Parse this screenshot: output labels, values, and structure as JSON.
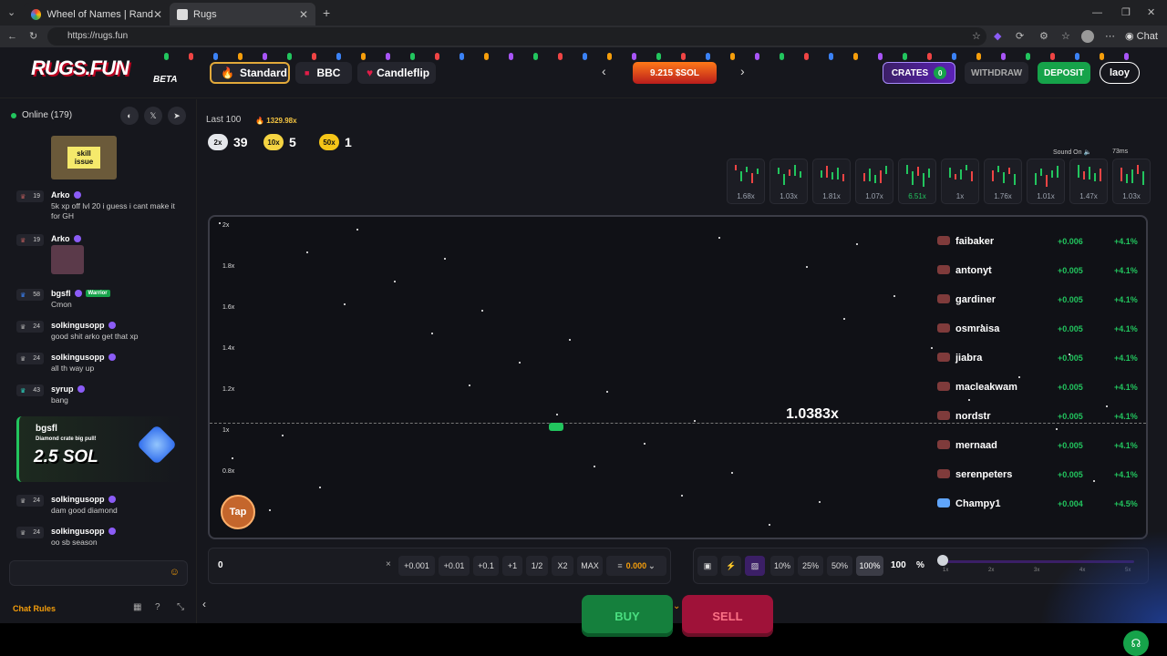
{
  "browser": {
    "tabs": [
      {
        "title": "Wheel of Names | Random name pi"
      },
      {
        "title": "Rugs"
      }
    ],
    "url": "https://rugs.fun"
  },
  "header": {
    "logo": "RUGS.FUN",
    "beta": "BETA",
    "modes": [
      "Standard",
      "BBC",
      "Candleflip"
    ],
    "pot": "9.215 $SOL",
    "crates": "CRATES",
    "crates_count": "0",
    "withdraw": "WITHDRAW",
    "deposit": "DEPOSIT",
    "user": "laoy"
  },
  "sidebar": {
    "online": "Online (179)",
    "messages": [
      {
        "level": "19",
        "name": "Arko",
        "text": "5k xp off lvl 20 i guess i cant make it for GH"
      },
      {
        "level": "19",
        "name": "Arko",
        "text": ""
      },
      {
        "level": "58",
        "name": "bgsfl",
        "text": "Cmon",
        "tag": "Warrior"
      },
      {
        "level": "24",
        "name": "solkingusopp",
        "text": "good shit arko get that xp"
      },
      {
        "level": "24",
        "name": "solkingusopp",
        "text": "all th way up"
      },
      {
        "level": "43",
        "name": "syrup",
        "text": "bang"
      },
      {
        "level": "24",
        "name": "solkingusopp",
        "text": "dam good diamond"
      },
      {
        "level": "24",
        "name": "solkingusopp",
        "text": "oo sb season"
      }
    ],
    "skill_issue": "skill issue",
    "crate_pull": {
      "name": "bgsfl",
      "text": "Diamond crate big pull!",
      "amount": "2.5 SOL"
    },
    "chat_rules": "Chat Rules"
  },
  "stats": {
    "last100_label": "Last 100",
    "last100_sol": "1329.98x",
    "badges": [
      {
        "mult": "2x",
        "count": "39",
        "color": "#e5e7eb"
      },
      {
        "mult": "10x",
        "count": "5",
        "color": "#f5d442"
      },
      {
        "mult": "50x",
        "count": "1",
        "color": "#f5c518"
      }
    ],
    "history": [
      "1.68x",
      "1.03x",
      "1.81x",
      "1.07x",
      "6.51x",
      "1x",
      "1.76x",
      "1.01x",
      "1.47x",
      "1.03x"
    ],
    "sound": "Sound On",
    "ping": "73ms"
  },
  "chart": {
    "ylabels": [
      "2x",
      "1.8x",
      "1.6x",
      "1.4x",
      "1.2x",
      "1x",
      "0.8x"
    ],
    "multiplier": "1.0383x",
    "tap": "Tap",
    "players": [
      {
        "name": "faibaker",
        "amount": "+0.006",
        "pct": "+4.1%"
      },
      {
        "name": "antonyt",
        "amount": "+0.005",
        "pct": "+4.1%"
      },
      {
        "name": "gardiner",
        "amount": "+0.005",
        "pct": "+4.1%"
      },
      {
        "name": "osmraisa",
        "amount": "+0.005",
        "pct": "+4.1%"
      },
      {
        "name": "jiabra",
        "amount": "+0.005",
        "pct": "+4.1%"
      },
      {
        "name": "macleakwam",
        "amount": "+0.005",
        "pct": "+4.1%"
      },
      {
        "name": "nordstr",
        "amount": "+0.005",
        "pct": "+4.1%"
      },
      {
        "name": "mernaad",
        "amount": "+0.005",
        "pct": "+4.1%"
      },
      {
        "name": "serenpeters",
        "amount": "+0.005",
        "pct": "+4.1%"
      },
      {
        "name": "Champy1",
        "amount": "+0.004",
        "pct": "+4.5%"
      }
    ]
  },
  "trade": {
    "amount": "0",
    "clear": "×",
    "quick": [
      "+0.001",
      "+0.01",
      "+0.1",
      "+1",
      "1/2",
      "X2",
      "MAX"
    ],
    "balance": "0.000",
    "pcts": [
      "10%",
      "25%",
      "50%",
      "100%"
    ],
    "pct_value": "100",
    "pct_sign": "%",
    "slider_labels": [
      "1x",
      "2x",
      "3x",
      "4x",
      "5x"
    ],
    "buy": "BUY",
    "sell": "SELL"
  }
}
